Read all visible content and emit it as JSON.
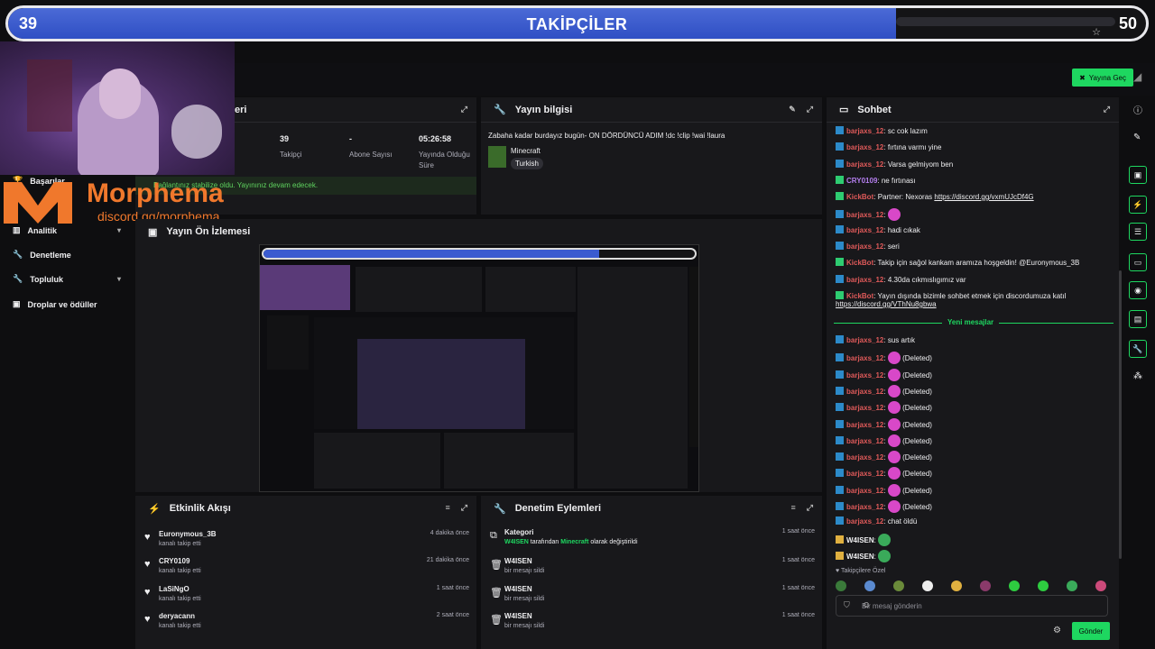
{
  "goal": {
    "title": "TAKİPÇİLER",
    "current": "39",
    "target": "50",
    "progress": 0.78
  },
  "header": {
    "go_live": "Yayına Geç"
  },
  "nav": {
    "items": [
      {
        "label": "Başarılar",
        "chevron": false
      },
      {
        "label": "Analitik",
        "chevron": true
      },
      {
        "label": "Denetleme",
        "chevron": false
      },
      {
        "label": "Topluluk",
        "chevron": true
      },
      {
        "label": "Droplar ve ödüller",
        "chevron": false
      }
    ]
  },
  "logo": {
    "name": "Morphema",
    "url": "discord.gg/morphema"
  },
  "stats_panel": {
    "title_fragment": "eri",
    "stats": [
      {
        "value": "39",
        "label": "Takipçi"
      },
      {
        "value": "-",
        "label": "Abone Sayısı"
      },
      {
        "value": "05:26:58",
        "label": "Yayında Olduğu Süre"
      }
    ],
    "notice": "Bağlantınız stabilize oldu. Yayınınız devam edecek."
  },
  "stream_info": {
    "title": "Yayın bilgisi",
    "stream_title": "Zabaha kadar burdayız bugün- ON DÖRDÜNCÜ ADIM !dc !clip !wai !laura",
    "category": "Minecraft",
    "tag": "Turkish"
  },
  "preview": {
    "title": "Yayın Ön İzlemesi"
  },
  "activity": {
    "title": "Etkinlik Akışı",
    "rows": [
      {
        "name": "Euronymous_3B",
        "sub": "kanalı takip etti",
        "time": "4 dakika önce"
      },
      {
        "name": "CRY0109",
        "sub": "kanalı takip etti",
        "time": "21 dakika önce"
      },
      {
        "name": "LaSiNgO",
        "sub": "kanalı takip etti",
        "time": "1 saat önce"
      },
      {
        "name": "deryacann",
        "sub": "kanalı takip etti",
        "time": "2 saat önce"
      }
    ]
  },
  "moderation": {
    "title": "Denetim Eylemleri",
    "rows": [
      {
        "name": "Kategori",
        "sub_user": "W4ISEN",
        "sub_mid": "tarafından",
        "sub_cat": "Minecraft",
        "sub_end": "olarak değiştirildi",
        "time": "1 saat önce"
      },
      {
        "name": "W4ISEN",
        "sub": "bir mesajı sildi",
        "time": "1 saat önce"
      },
      {
        "name": "W4ISEN",
        "sub": "bir mesajı sildi",
        "time": "1 saat önce"
      },
      {
        "name": "W4ISEN",
        "sub": "bir mesajı sildi",
        "time": "1 saat önce"
      }
    ]
  },
  "chat": {
    "title": "Sohbet",
    "new_messages": "Yeni mesajlar",
    "followers_only": "Takipçilere Özel",
    "input_placeholder": "Bir mesaj gönderin",
    "send": "Gönder",
    "messages_before": [
      {
        "user": "barjaxs_12",
        "color": "#e05a5a",
        "text": "sc cok lazım"
      },
      {
        "user": "barjaxs_12",
        "color": "#e05a5a",
        "text": "fırtına varmı yine"
      },
      {
        "user": "barjaxs_12",
        "color": "#e05a5a",
        "text": "Varsa gelmiyom ben"
      },
      {
        "user": "CRY0109",
        "color": "#b57ff0",
        "text": "ne fırtınası"
      },
      {
        "user": "KickBot",
        "color": "#e05a5a",
        "text": "Partner: Nexoras ",
        "link": "https://discord.gg/vxmUJcDf4G"
      },
      {
        "user": "barjaxs_12",
        "color": "#e05a5a",
        "text": "",
        "emote": true
      },
      {
        "user": "barjaxs_12",
        "color": "#e05a5a",
        "text": "hadi cıkak"
      },
      {
        "user": "barjaxs_12",
        "color": "#e05a5a",
        "text": "seri"
      },
      {
        "user": "KickBot",
        "color": "#e05a5a",
        "text": "Takip için sağol kankam aramıza hoşgeldin! @Euronymous_3B"
      },
      {
        "user": "barjaxs_12",
        "color": "#e05a5a",
        "text": "4.30da cıkmıslıgımız var"
      },
      {
        "user": "KickBot",
        "color": "#e05a5a",
        "text": "Yayın dışında bizimle sohbet etmek için discordumuza katıl",
        "link2": "https://discord.gg/VThNu8gbwa"
      }
    ],
    "messages_after": [
      {
        "user": "barjaxs_12",
        "text": "sus artık"
      },
      {
        "user": "barjaxs_12",
        "text": "(Deleted)",
        "emote": true
      },
      {
        "user": "barjaxs_12",
        "text": "(Deleted)",
        "emote": true
      },
      {
        "user": "barjaxs_12",
        "text": "(Deleted)",
        "emote": true
      },
      {
        "user": "barjaxs_12",
        "text": "(Deleted)",
        "emote": true
      },
      {
        "user": "barjaxs_12",
        "text": "(Deleted)",
        "emote": true
      },
      {
        "user": "barjaxs_12",
        "text": "(Deleted)",
        "emote": true
      },
      {
        "user": "barjaxs_12",
        "text": "(Deleted)",
        "emote": true
      },
      {
        "user": "barjaxs_12",
        "text": "(Deleted)",
        "emote": true
      },
      {
        "user": "barjaxs_12",
        "text": "(Deleted)",
        "emote": true
      },
      {
        "user": "barjaxs_12",
        "text": "(Deleted)",
        "emote": true
      },
      {
        "user": "barjaxs_12",
        "text": "chat öldü"
      },
      {
        "user": "W4ISEN",
        "text": "",
        "emote": true,
        "green": true
      },
      {
        "user": "W4ISEN",
        "text": "",
        "emote": true,
        "green": true
      }
    ]
  },
  "colors": {
    "accent": "#1ed760",
    "goal_fill": "#3b5bd0",
    "username_red": "#e05a5a",
    "logo_orange": "#f0782c"
  }
}
